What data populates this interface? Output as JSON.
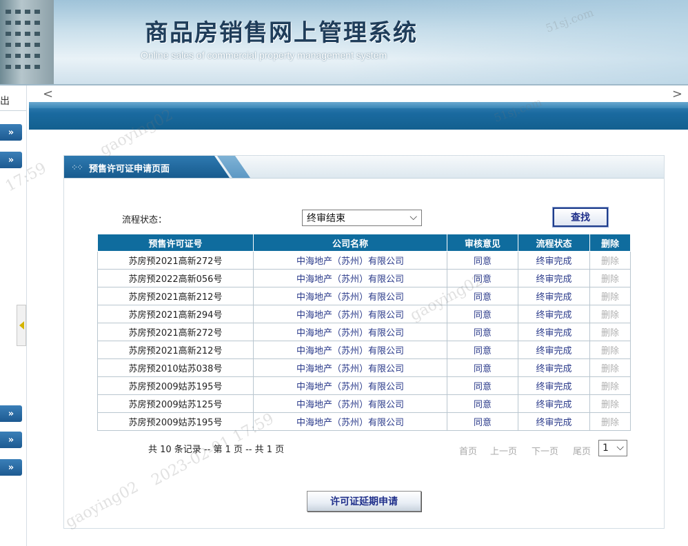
{
  "header": {
    "title": "商品房销售网上管理系统",
    "subtitle": "Online sales of commercial property management system"
  },
  "sidebar": {
    "exit_label": "出",
    "expand_glyph": "»"
  },
  "nav": {
    "left_arrow": "<",
    "right_arrow": ">"
  },
  "panel": {
    "title": "预售许可证申请页面",
    "title_icon": "dots-icon"
  },
  "filter": {
    "label": "流程状态：",
    "selected": "终审结束",
    "search_button": "查找"
  },
  "table": {
    "columns": [
      "预售许可证号",
      "公司名称",
      "审核意见",
      "流程状态",
      "删除"
    ],
    "rows": [
      {
        "permit": "苏房预2021高新272号",
        "company": "中海地产（苏州）有限公司",
        "opinion": "同意",
        "status": "终审完成",
        "del": "删除"
      },
      {
        "permit": "苏房预2022高新056号",
        "company": "中海地产（苏州）有限公司",
        "opinion": "同意",
        "status": "终审完成",
        "del": "删除"
      },
      {
        "permit": "苏房预2021高新212号",
        "company": "中海地产（苏州）有限公司",
        "opinion": "同意",
        "status": "终审完成",
        "del": "删除"
      },
      {
        "permit": "苏房预2021高新294号",
        "company": "中海地产（苏州）有限公司",
        "opinion": "同意",
        "status": "终审完成",
        "del": "删除"
      },
      {
        "permit": "苏房预2021高新272号",
        "company": "中海地产（苏州）有限公司",
        "opinion": "同意",
        "status": "终审完成",
        "del": "删除"
      },
      {
        "permit": "苏房预2021高新212号",
        "company": "中海地产（苏州）有限公司",
        "opinion": "同意",
        "status": "终审完成",
        "del": "删除"
      },
      {
        "permit": "苏房预2010姑苏038号",
        "company": "中海地产（苏州）有限公司",
        "opinion": "同意",
        "status": "终审完成",
        "del": "删除"
      },
      {
        "permit": "苏房预2009姑苏195号",
        "company": "中海地产（苏州）有限公司",
        "opinion": "同意",
        "status": "终审完成",
        "del": "删除"
      },
      {
        "permit": "苏房预2009姑苏125号",
        "company": "中海地产（苏州）有限公司",
        "opinion": "同意",
        "status": "终审完成",
        "del": "删除"
      },
      {
        "permit": "苏房预2009姑苏195号",
        "company": "中海地产（苏州）有限公司",
        "opinion": "同意",
        "status": "终审完成",
        "del": "删除"
      }
    ]
  },
  "pagination": {
    "summary": "共 10 条记录 -- 第 1 页 -- 共 1 页",
    "first": "首页",
    "prev": "上一页",
    "next": "下一页",
    "last": "尾页",
    "page_selected": "1"
  },
  "actions": {
    "extend_button": "许可证延期申请"
  },
  "watermark": {
    "user": "gaoying02",
    "datetime": "2023-02-01 17:59",
    "site": "51sj.com",
    "time": "17:59"
  },
  "colors": {
    "header_blue": "#0f6c9e",
    "link_blue": "#2a3a8a",
    "disabled_gray": "#b0b0b0"
  }
}
